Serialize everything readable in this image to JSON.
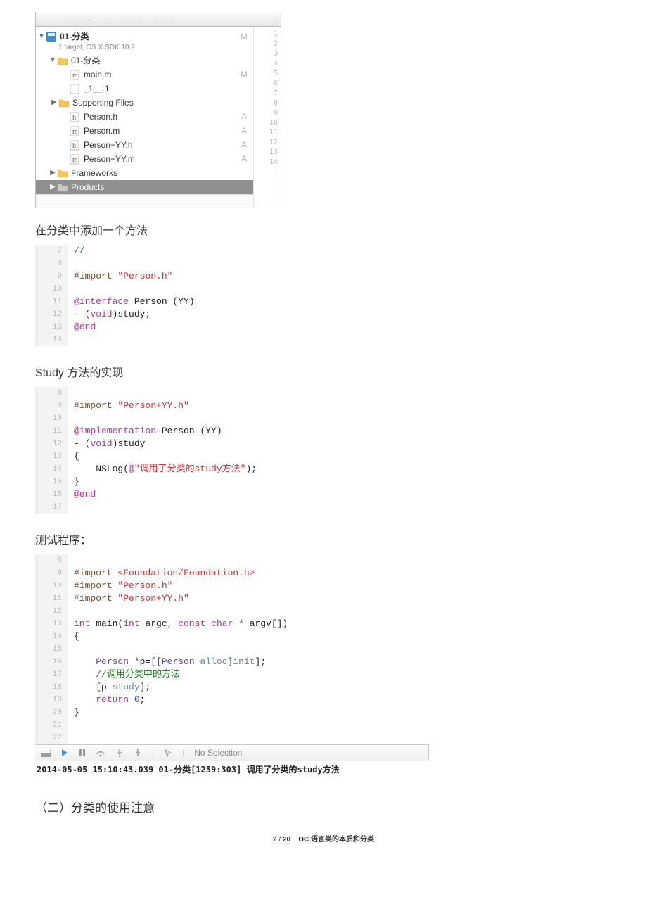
{
  "navigator": {
    "project": {
      "name": "01-分类",
      "subtitle": "1 target, OS X SDK 10.9",
      "badge": "M"
    },
    "group": {
      "name": "01-分类"
    },
    "files": [
      {
        "key": "main",
        "name": "main.m",
        "icon": "m",
        "badge": "M"
      },
      {
        "key": "temp",
        "name": "_1__.1",
        "icon": "blank",
        "badge": ""
      },
      {
        "key": "support",
        "name": "Supporting Files",
        "icon": "folder",
        "badge": "",
        "folder": true,
        "disc": "▶"
      },
      {
        "key": "ph",
        "name": "Person.h",
        "icon": "h",
        "badge": "A"
      },
      {
        "key": "pm",
        "name": "Person.m",
        "icon": "m",
        "badge": "A"
      },
      {
        "key": "pyh",
        "name": "Person+YY.h",
        "icon": "h",
        "badge": "A"
      },
      {
        "key": "pym",
        "name": "Person+YY.m",
        "icon": "m",
        "badge": "A"
      }
    ],
    "frameworks": {
      "name": "Frameworks"
    },
    "products": {
      "name": "Products"
    },
    "side_numbers": [
      "1",
      "2",
      "3",
      "4",
      "5",
      "6",
      "7",
      "8",
      "9",
      "10",
      "11",
      "12",
      "13",
      "14"
    ]
  },
  "heading1": "在分类中添加一个方法",
  "code1": {
    "start": 7,
    "lines": [
      [
        [
          "c-comment",
          "//"
        ]
      ],
      [],
      [
        [
          "c-prep",
          "#import "
        ],
        [
          "c-string",
          "\"Person.h\""
        ]
      ],
      [],
      [
        [
          "c-keyword",
          "@interface "
        ],
        [
          "c-plain",
          "Person (YY)"
        ]
      ],
      [
        [
          "c-plain",
          "- ("
        ],
        [
          "c-keyword",
          "void"
        ],
        [
          "c-plain",
          ")study;"
        ]
      ],
      [
        [
          "c-keyword",
          "@end"
        ]
      ],
      []
    ]
  },
  "heading2": "Study 方法的实现",
  "code2": {
    "start": 8,
    "lines": [
      [],
      [
        [
          "c-prep",
          "#import "
        ],
        [
          "c-string",
          "\"Person+YY.h\""
        ]
      ],
      [],
      [
        [
          "c-keyword",
          "@implementation "
        ],
        [
          "c-plain",
          "Person (YY)"
        ]
      ],
      [
        [
          "c-plain",
          "- ("
        ],
        [
          "c-keyword",
          "void"
        ],
        [
          "c-plain",
          ")study"
        ]
      ],
      [
        [
          "c-plain",
          "{"
        ]
      ],
      [
        [
          "c-plain",
          "    NSLog("
        ],
        [
          "c-keyword",
          "@"
        ],
        [
          "c-string",
          "\"调用了分类的study方法\""
        ],
        [
          "c-plain",
          ");"
        ]
      ],
      [
        [
          "c-plain",
          "}"
        ]
      ],
      [
        [
          "c-keyword",
          "@end"
        ]
      ],
      []
    ]
  },
  "heading3": "测试程序：",
  "code3": {
    "start": 8,
    "lines": [
      [],
      [
        [
          "c-prep",
          "#import "
        ],
        [
          "c-string",
          "<Foundation/Foundation.h>"
        ]
      ],
      [
        [
          "c-prep",
          "#import "
        ],
        [
          "c-string",
          "\"Person.h\""
        ]
      ],
      [
        [
          "c-prep",
          "#import "
        ],
        [
          "c-string",
          "\"Person+YY.h\""
        ]
      ],
      [],
      [
        [
          "c-keyword",
          "int "
        ],
        [
          "c-plain",
          "main("
        ],
        [
          "c-keyword",
          "int"
        ],
        [
          "c-plain",
          " argc, "
        ],
        [
          "c-keyword",
          "const char"
        ],
        [
          "c-plain",
          " * argv[])"
        ]
      ],
      [
        [
          "c-plain",
          "{"
        ]
      ],
      [],
      [
        [
          "c-plain",
          "    "
        ],
        [
          "c-type",
          "Person"
        ],
        [
          "c-plain",
          " *p=[["
        ],
        [
          "c-type",
          "Person"
        ],
        [
          "c-plain",
          " "
        ],
        [
          "c-class",
          "alloc"
        ],
        [
          "c-plain",
          "]"
        ],
        [
          "c-class",
          "init"
        ],
        [
          "c-plain",
          "];"
        ]
      ],
      [
        [
          "c-plain",
          "    "
        ],
        [
          "c-comment",
          "//调用分类中的方法"
        ]
      ],
      [
        [
          "c-plain",
          "    [p "
        ],
        [
          "c-class",
          "study"
        ],
        [
          "c-plain",
          "];"
        ]
      ],
      [
        [
          "c-plain",
          "    "
        ],
        [
          "c-keyword",
          "return"
        ],
        [
          "c-plain",
          " "
        ],
        [
          "c-num",
          "0"
        ],
        [
          "c-plain",
          ";"
        ]
      ],
      [
        [
          "c-plain",
          "}"
        ]
      ],
      [],
      []
    ]
  },
  "debug_bar": {
    "no_selection": "No Selection"
  },
  "console_line": "2014-05-05 15:10:43.039 01-分类[1259:303] 调用了分类的study方法",
  "section2": "（二）分类的使用注意",
  "footer": {
    "page": "2",
    "total": "20",
    "title": "OC 语言类的本质和分类"
  }
}
